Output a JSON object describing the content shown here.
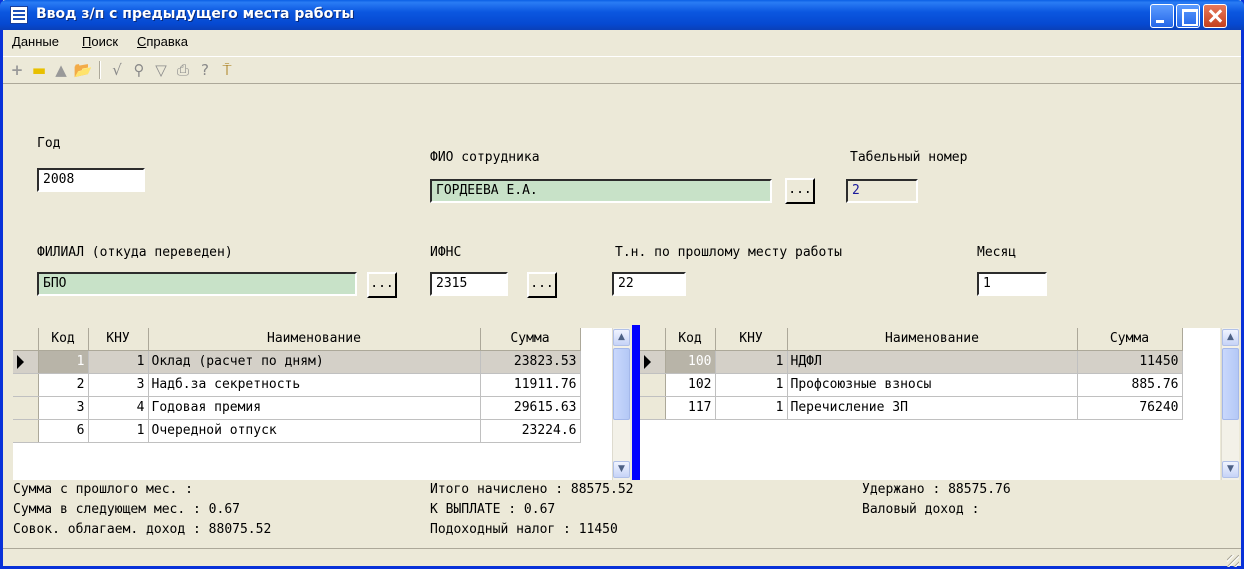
{
  "window": {
    "title": "Ввод з/п с предыдущего места работы"
  },
  "menu": [
    {
      "label": "Данные",
      "underline": "Д",
      "rest": "анные"
    },
    {
      "label": "Поиск",
      "underline": "П",
      "rest": "оиск"
    },
    {
      "label": "Справка",
      "underline": "С",
      "rest": "правка"
    }
  ],
  "toolbar": {
    "icons": [
      "plus-icon",
      "minus-icon",
      "up-icon",
      "open-folder-icon",
      "check-icon",
      "binoculars-icon",
      "filter-icon",
      "print-icon",
      "help-icon",
      "exit-icon"
    ],
    "glyphs": {
      "plus": "+",
      "minus": "▬",
      "up": "▲",
      "folder": "📂",
      "check": "√",
      "search": "⚲",
      "filter": "▽",
      "print": "⎙",
      "help": "?",
      "exit": "⍑"
    }
  },
  "form": {
    "year_label": "Год",
    "year_value": "2008",
    "fio_label": "ФИО сотрудника",
    "fio_value": "ГОРДЕЕВА Е.А.",
    "tab_label": "Табельный номер",
    "tab_value": "2",
    "branch_label": "ФИЛИАЛ (откуда переведен)",
    "branch_value": "БПО",
    "ifns_label": "ИФНС",
    "ifns_value": "2315",
    "prev_tab_label": "Т.н. по прошлому месту работы",
    "prev_tab_value": "22",
    "month_label": "Месяц",
    "month_value": "1",
    "dots": "..."
  },
  "left_grid": {
    "headers": [
      "Код",
      "КНУ",
      "Наименование",
      "Сумма"
    ],
    "rows": [
      {
        "kod": "1",
        "knu": "1",
        "name": "Оклад (расчет по дням)",
        "sum": "23823.53"
      },
      {
        "kod": "2",
        "knu": "3",
        "name": "Надб.за секретность",
        "sum": "11911.76"
      },
      {
        "kod": "3",
        "knu": "4",
        "name": "Годовая премия",
        "sum": "29615.63"
      },
      {
        "kod": "6",
        "knu": "1",
        "name": "Очередной отпуск",
        "sum": "23224.6"
      }
    ]
  },
  "right_grid": {
    "headers": [
      "Код",
      "КНУ",
      "Наименование",
      "Сумма"
    ],
    "rows": [
      {
        "kod": "100",
        "knu": "1",
        "name": "НДФЛ",
        "sum": "11450"
      },
      {
        "kod": "102",
        "knu": "1",
        "name": "Профсоюзные взносы",
        "sum": "885.76"
      },
      {
        "kod": "117",
        "knu": "1",
        "name": "Перечисление ЗП",
        "sum": "76240"
      }
    ]
  },
  "summary": {
    "prev_month": "Сумма с прошлого мес. :",
    "next_month": "Сумма в следующем мес. : 0.67",
    "taxable_income": "Совок. облагаем. доход : 88075.52",
    "total_accrued": "Итого начислено : 88575.52",
    "to_pay": "К ВЫПЛАТЕ : 0.67",
    "income_tax": "Подоходный налог : 11450",
    "withheld": "Удержано : 88575.76",
    "gross_income": "Валовый доход :"
  },
  "colors": {
    "titlebar": "#0a5fe5",
    "green_field": "#c8e2c8",
    "splitter": "#0000ff",
    "window_bg": "#ece9d8"
  }
}
